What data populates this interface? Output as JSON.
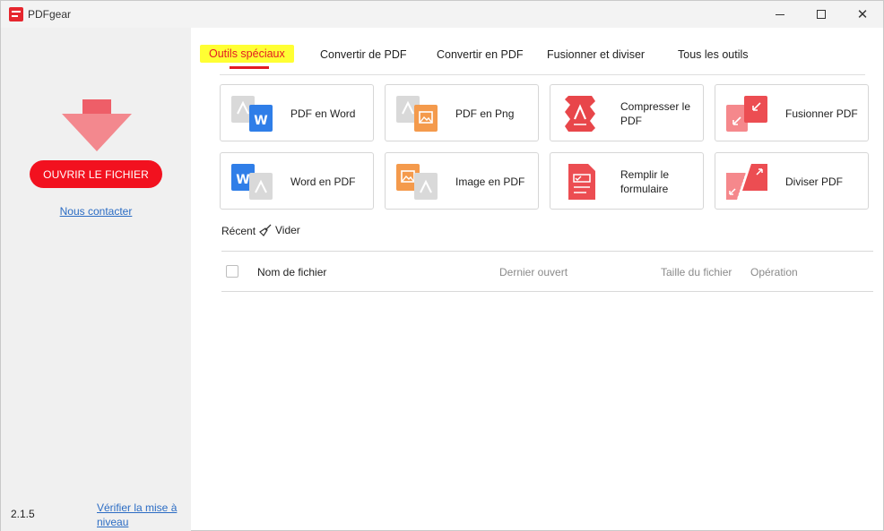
{
  "window": {
    "title": "PDFgear"
  },
  "sidebar": {
    "open_button": "OUVRIR LE FICHIER",
    "contact_link": "Nous contacter",
    "version": "2.1.5",
    "update_link": "Vérifier la mise à niveau"
  },
  "tabs": [
    {
      "label": "Outils spéciaux",
      "active": true
    },
    {
      "label": "Convertir de PDF",
      "active": false
    },
    {
      "label": "Convertir en PDF",
      "active": false
    },
    {
      "label": "Fusionner et diviser",
      "active": false
    },
    {
      "label": "Tous les outils",
      "active": false
    }
  ],
  "tools": [
    {
      "label": "PDF en Word",
      "icon": "pdf-to-word-icon"
    },
    {
      "label": "PDF en Png",
      "icon": "pdf-to-png-icon"
    },
    {
      "label": "Compresser le PDF",
      "icon": "compress-pdf-icon"
    },
    {
      "label": "Fusionner PDF",
      "icon": "merge-pdf-icon"
    },
    {
      "label": "Word en PDF",
      "icon": "word-to-pdf-icon"
    },
    {
      "label": "Image en PDF",
      "icon": "image-to-pdf-icon"
    },
    {
      "label": "Remplir le formulaire",
      "icon": "fill-form-icon"
    },
    {
      "label": "Diviser PDF",
      "icon": "split-pdf-icon"
    }
  ],
  "recent": {
    "title": "Récent",
    "clear_label": "Vider",
    "columns": {
      "name": "Nom de fichier",
      "last_opened": "Dernier ouvert",
      "size": "Taille du fichier",
      "operation": "Opération"
    }
  },
  "colors": {
    "accent_red": "#f2111f",
    "word_blue": "#2f7ee8",
    "image_orange": "#f49a4c",
    "highlight_yellow": "#ffff33",
    "link_blue": "#2b6cc4"
  }
}
